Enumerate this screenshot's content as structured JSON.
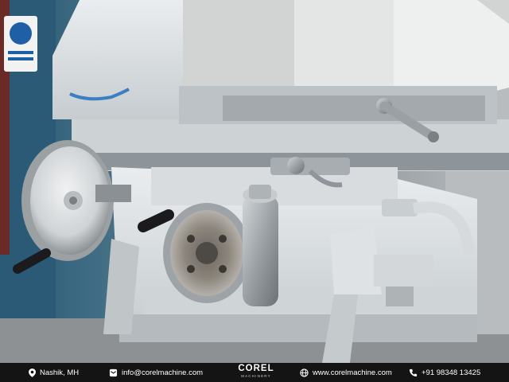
{
  "photo": {
    "subject": "surface-grinding-machine",
    "colors": {
      "machine_body": "#dfe3e6",
      "steel": "#9ea3a6",
      "shadow": "#5d6266",
      "background_blue": "#2d5e78",
      "handle": "#1b1b1d",
      "footer_bg": "#141414"
    }
  },
  "footer": {
    "location": "Nashik, MH",
    "email": "info@corelmachine.com",
    "brand": "COREL",
    "brand_sub": "MACHINERY",
    "website": "www.corelmachine.com",
    "phone": "+91 98348 13425",
    "icons": [
      "location-pin-icon",
      "mail-icon",
      "globe-icon",
      "phone-icon"
    ]
  }
}
